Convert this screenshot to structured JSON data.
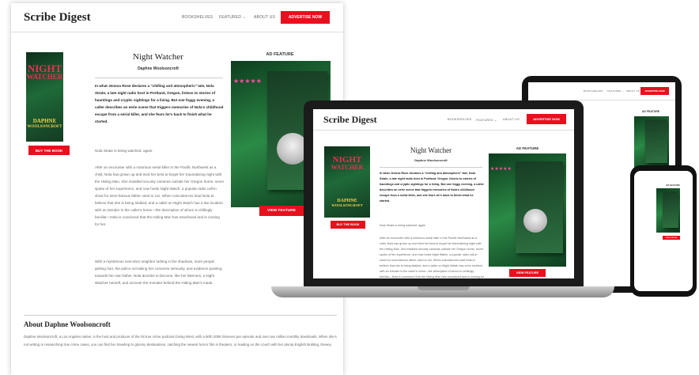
{
  "site": {
    "brand": "Scribe Digest",
    "nav": [
      "BOOKSHELVES",
      "FEATURED ⌄",
      "ABOUT US"
    ],
    "advertise_label": "ADVERTISE NOW"
  },
  "book": {
    "cover_top": "\"THRILLING AND ATMOSPHERIC\" · CITING BOOK",
    "cover_title_1": "NIGHT",
    "cover_title_2": "WATCHER",
    "cover_a_novel": "A NOVEL",
    "cover_author_1": "DAPHNE",
    "cover_author_2": "WOOLSONCROFT",
    "cover_tagline": "BESTSELLING AUTHOR · THE STRANDS",
    "title": "Night Watcher",
    "author": "Daphne Woolsoncroft",
    "buy_label": "BUY THE BOOK"
  },
  "article": {
    "intro": "In what Jenova Rose declares a \"chilling and atmospheric\" tale, Nola Strate, a late night radio host in Portland, Oregon, listens to stories of hauntings and cryptic sightings for a living. But one foggy evening, a caller describes an eerie scene that triggers memories of Nola's childhood escape from a serial killer, and she fears he's back to finish what he started.",
    "p1": "Nola Strate is being watched, again.",
    "p2": "After an encounter with a notorious serial killer in the Pacific Northwest as a child, Nola has grown up and tried her best to forget her traumatizing night with the Hiding Man. She installed security cameras outside her Oregon home, never spoke of her experience, and now hosts Night Watch, a popular radio call-in show for semi-famous father used to run. When coincidences lead Nola to believe that she is being stalked, and a caller on Night Watch has a live incident with an intruder in the caller's home—the description of whom is chillingly familiar—Nola is convinced that the Hiding Man has resurfaced and is coming for her.",
    "p3": "With a mysterious next-door neighbor lurking in the shadows, more people getting hurt, the police not taking her concerns seriously, and evidence pointing towards her own father, Nola decides to become, like her listeners, a Night Watcher herself, and uncover the monster behind the Hiding Man's mask."
  },
  "ad": {
    "label": "AD FEATURE",
    "button": "VIEW FEATURE",
    "book_title": "NIGHT WATCHER",
    "book_author": "DAPHNE WOOLSONCROFT",
    "stars": "★★★★★"
  },
  "about": {
    "heading": "About Daphne Woolsoncroft",
    "text": "Daphne Woolsoncroft, a Los Angeles native, is the host and producer of the hit true crime podcast Giving West, with a 50th 200K listeners per episode and over two million monthly downloads. When she's not writing or researching true crime cases, you can find her traveling to gloomy destinations, catching the newest horror film in theaters, or reading on the couch with her plump English Bulldog, Dewey."
  },
  "colors": {
    "accent_red": "#e8101d",
    "book_green": "#1f6a38",
    "title_pink": "#ef2e53",
    "author_yellow": "#f2d34a"
  }
}
